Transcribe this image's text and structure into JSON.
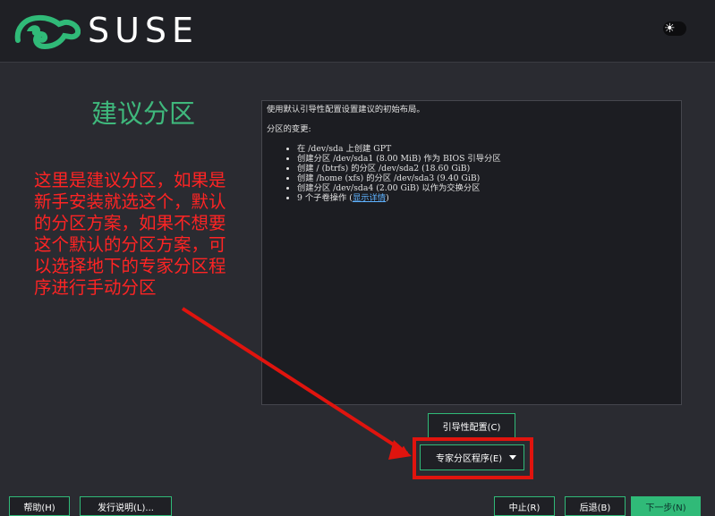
{
  "header": {
    "brand": "SUSE",
    "logo_icon": "chameleon-logo-icon",
    "theme_icon": "sun-icon"
  },
  "page": {
    "title": "建议分区"
  },
  "info": {
    "intro": "使用默认引导性配置设置建议的初始布局。",
    "changes_heading": "分区的变更:",
    "changes": [
      "在 /dev/sda 上创建 GPT",
      "创建分区 /dev/sda1 (8.00 MiB) 作为 BIOS 引导分区",
      "创建 / (btrfs) 的分区 /dev/sda2 (18.60 GiB)",
      "创建 /home (xfs) 的分区 /dev/sda3 (9.40 GiB)",
      "创建分区 /dev/sda4 (2.00 GiB) 以作为交换分区"
    ],
    "subvolume_prefix": "9 个子卷操作 (",
    "subvolume_link": "显示详情",
    "subvolume_suffix": ")"
  },
  "annotation": {
    "text": "这里是建议分区，如果是新手安装就选这个，默认的分区方案，如果不想要这个默认的分区方案，可以选择地下的专家分区程序进行手动分区",
    "color": "#ff2424"
  },
  "buttons": {
    "bootloader": "引导性配置(C)",
    "expert": "专家分区程序(E)",
    "help": "帮助(H)",
    "release_notes": "发行说明(L)...",
    "abort": "中止(R)",
    "back": "后退(B)",
    "next": "下一步(N)"
  },
  "colors": {
    "accent": "#30ba78",
    "title": "#3fb87c",
    "highlight": "#e0140e",
    "background": "#2a2b31"
  }
}
